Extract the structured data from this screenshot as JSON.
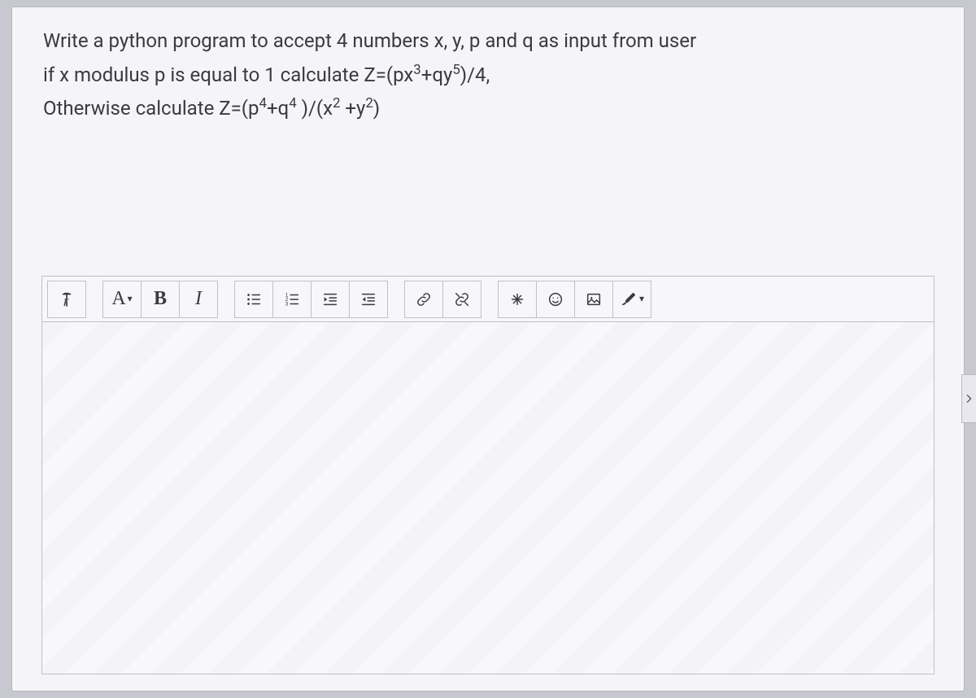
{
  "question": {
    "line1": "Write a python program to accept 4 numbers x, y, p and q as input from user",
    "line2_pre": "if x modulus p is equal to 1 calculate Z=(px",
    "line2_sup1": "3",
    "line2_mid": "+qy",
    "line2_sup2": "5",
    "line2_post": ")/4,",
    "line3_pre": "Otherwise calculate Z=(p",
    "line3_sup1": "4",
    "line3_mid1": "+q",
    "line3_sup2": "4",
    "line3_mid2": " )/(x",
    "line3_sup3": "2",
    "line3_mid3": " +y",
    "line3_sup4": "2",
    "line3_post": ")"
  },
  "toolbar": {
    "font_label": "A",
    "bold_label": "B",
    "italic_label": "I"
  }
}
